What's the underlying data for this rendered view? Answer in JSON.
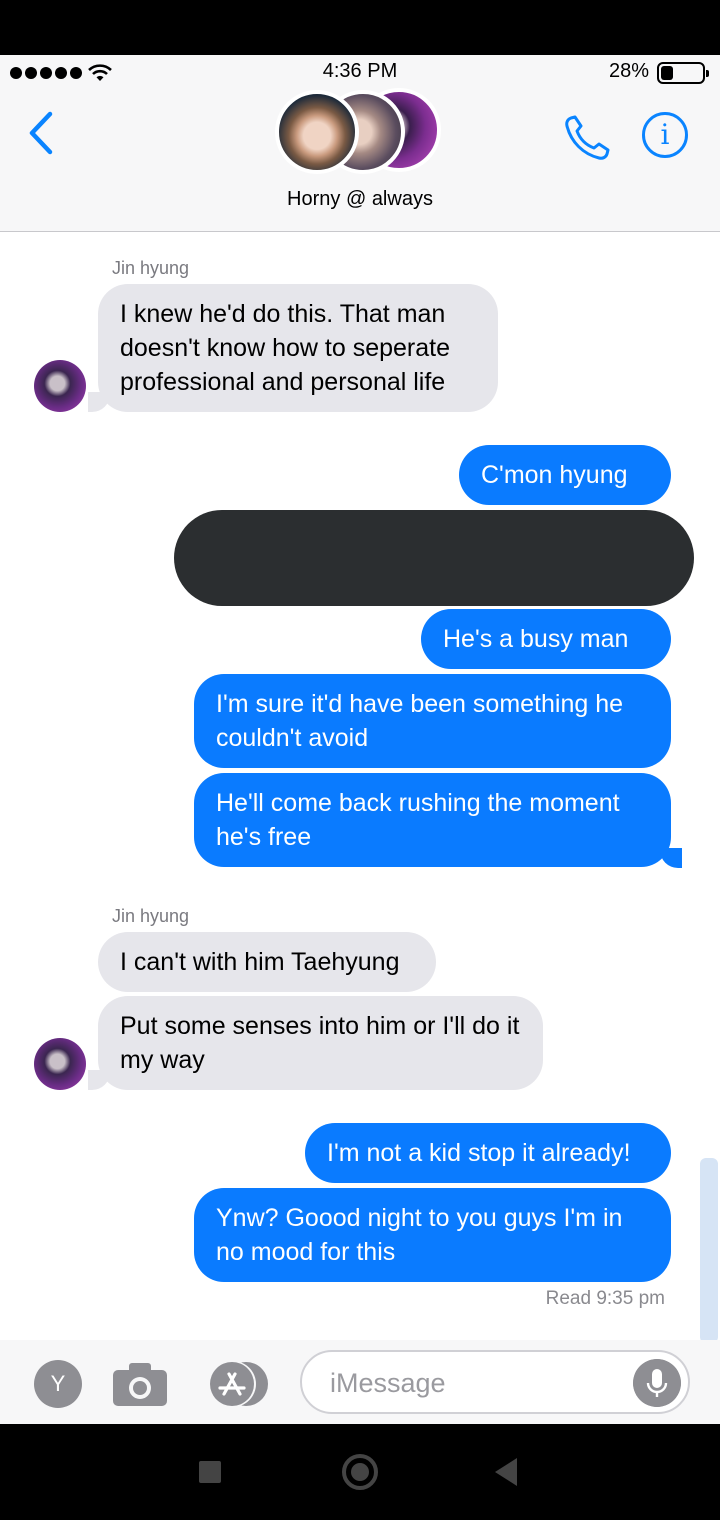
{
  "status_bar": {
    "time": "4:36 PM",
    "battery": "28%",
    "battery_level": 0.28
  },
  "header": {
    "group_name": "Horny @ always",
    "icons": [
      "back-chevron-icon",
      "phone-icon",
      "info-icon"
    ]
  },
  "messages": [
    {
      "sender": "Jin hyung",
      "text": "I knew he'd do this. That man doesn't know how to seperate professional and personal life"
    },
    {
      "text": "C'mon hyung"
    },
    {
      "text": "He's a busy man"
    },
    {
      "text": "I'm sure it'd have been something he couldn't avoid"
    },
    {
      "text": "He'll come back rushing the moment he's free"
    },
    {
      "sender": "Jin hyung",
      "text": "I can't with him Taehyung"
    },
    {
      "text": "Put some senses into him or I'll do it my way"
    },
    {
      "text": "I'm not a kid stop it already!"
    },
    {
      "text": "Ynw? Goood night to you guys I'm in no mood for this"
    }
  ],
  "read_receipt": "Read 9:35 pm",
  "composer": {
    "app_button": "Y",
    "placeholder": "iMessage"
  },
  "colors": {
    "outgoing": "#0a7bff",
    "incoming": "#e6e6eb",
    "accent": "#0a84ff"
  }
}
